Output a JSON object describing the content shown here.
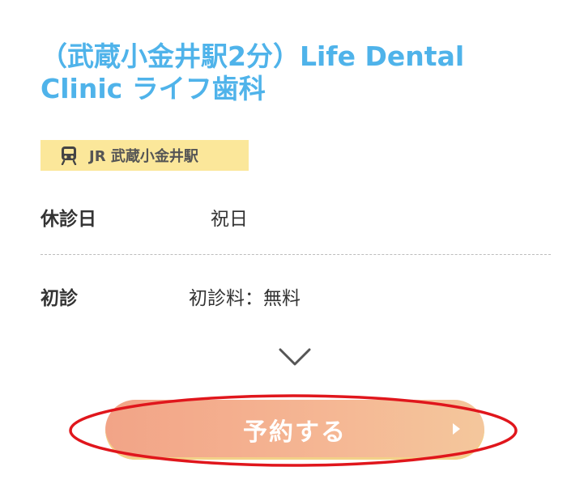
{
  "clinic": {
    "title": "（武蔵小金井駅2分）Life Dental Clinic ライフ歯科",
    "station_badge": "JR 武蔵小金井駅"
  },
  "info": {
    "holiday_label": "休診日",
    "holiday_value": "祝日",
    "first_visit_label": "初診",
    "first_visit_value": "初診料：無料"
  },
  "actions": {
    "reserve_label": "予約する",
    "expand_icon": "chevron-down-icon",
    "arrow_icon": "triangle-right-icon"
  },
  "colors": {
    "title": "#4fb3ea",
    "badge_background": "#fbe79a",
    "button_gradient_start": "#f2a487",
    "button_gradient_end": "#f4c79c",
    "highlight_ring": "#e0161c"
  }
}
